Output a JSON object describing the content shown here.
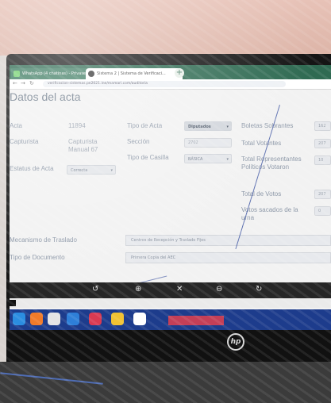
{
  "browser": {
    "tabs": [
      {
        "label": "WhatsApp (4 chatinas) - Privasec..."
      },
      {
        "label": "Sistema 2 | Sistema de Verificaci..."
      }
    ],
    "url": "verificacion-sistemas.pe2021.ine/mamari.com/auditoria"
  },
  "form": {
    "title": "Datos del acta",
    "acta_label": "Acta",
    "acta_value": "11894",
    "capturista_label": "Capturista",
    "capturista_value": "Capturista Manual 67",
    "estatus_label": "Estatus de Acta",
    "estatus_value": "Correcta",
    "tipo_acta_label": "Tipo de Acta",
    "tipo_acta_value": "Diputados",
    "seccion_label": "Sección",
    "seccion_value": "2702",
    "tipo_casilla_label": "Tipo de Casilla",
    "tipo_casilla_value": "BÁSICA",
    "boletas_label": "Boletas Sobrantes",
    "boletas_value": "162",
    "total_votantes_label": "Total Votantes",
    "total_votantes_value": "207",
    "representantes_label": "Total Representantes Políticos Votaron",
    "representantes_value": "10",
    "total_votos_label": "Total de Votos",
    "total_votos_value": "207",
    "votos_urna_label": "Votos sacados de la urna",
    "votos_urna_value": "0",
    "mecanismo_label": "Mecanismo de Traslado",
    "mecanismo_value": "Centros de Recepción y Traslado Fijos",
    "tipo_doc_label": "Tipo de Documento",
    "tipo_doc_value": "Primera Copia del AEC"
  },
  "icons": [
    "undo-icon",
    "zoom-in-icon",
    "expand-icon",
    "zoom-out-icon",
    "redo-icon"
  ],
  "brand": {
    "monitor_logo": "hp"
  },
  "colors": {
    "chrome": "#2f6a52",
    "taskbar": "#1d3c8c"
  }
}
